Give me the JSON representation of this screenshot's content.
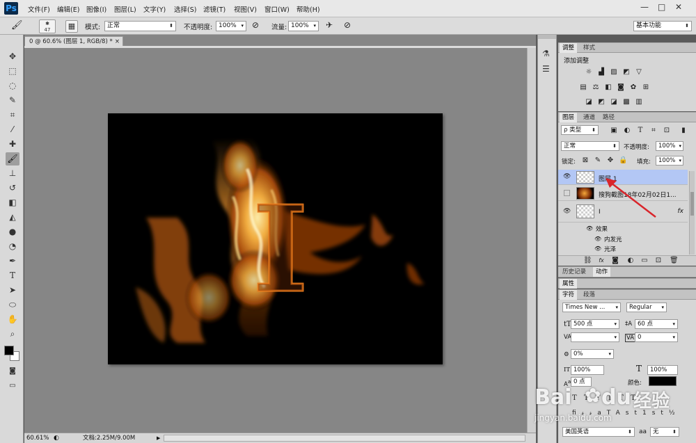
{
  "app": {
    "logo": "Ps"
  },
  "menu": [
    "文件(F)",
    "编辑(E)",
    "图像(I)",
    "图层(L)",
    "文字(Y)",
    "选择(S)",
    "滤镜(T)",
    "视图(V)",
    "窗口(W)",
    "帮助(H)"
  ],
  "window_controls": {
    "minimize": "—",
    "maximize": "□",
    "close": "✕"
  },
  "options": {
    "brush_size": "47",
    "mode_label": "模式:",
    "mode_value": "正常",
    "opacity_label": "不透明度:",
    "opacity_value": "100%",
    "flow_label": "流量:",
    "flow_value": "100%",
    "workspace": "基本功能"
  },
  "document": {
    "tab_title": "0 @ 60.6% (图层 1, RGB/8) *",
    "zoom": "60.61%",
    "doc_info": "文档:2.25M/9.00M",
    "canvas_letter": "I"
  },
  "adjustments": {
    "tabs": [
      "调整",
      "样式"
    ],
    "title": "添加调整"
  },
  "layers_panel": {
    "tabs": [
      "图层",
      "通道",
      "路径"
    ],
    "filter_label": "ρ 类型",
    "blend_mode": "正常",
    "opacity_label": "不透明度:",
    "opacity_value": "100%",
    "lock_label": "锁定:",
    "fill_label": "填充:",
    "fill_value": "100%",
    "layers": [
      {
        "name": "图层 1"
      },
      {
        "name": "搜狗截图18年02月02日1..."
      },
      {
        "name": "I",
        "fx": "fx"
      }
    ],
    "effects_label": "效果",
    "effects": [
      "内发光",
      "光泽"
    ]
  },
  "history": {
    "tabs": [
      "历史记录",
      "动作"
    ]
  },
  "properties": {
    "label": "属性"
  },
  "character": {
    "tabs": [
      "字符",
      "段落"
    ],
    "font_family": "Times New ...",
    "font_style": "Regular",
    "font_size": "500 点",
    "leading": "60 点",
    "kerning": "",
    "tracking": "0",
    "scale_pct": "0%",
    "vertical_scale": "100%",
    "horizontal_scale": "100%",
    "baseline": "0 点",
    "color_label": "颜色:",
    "language": "美国英语",
    "antialias": "无",
    "antialias_icon": "aa"
  },
  "watermark": {
    "brand": "Bai",
    "paw": "du",
    "cn": "经验",
    "url": "jingyan.baidu.com"
  }
}
